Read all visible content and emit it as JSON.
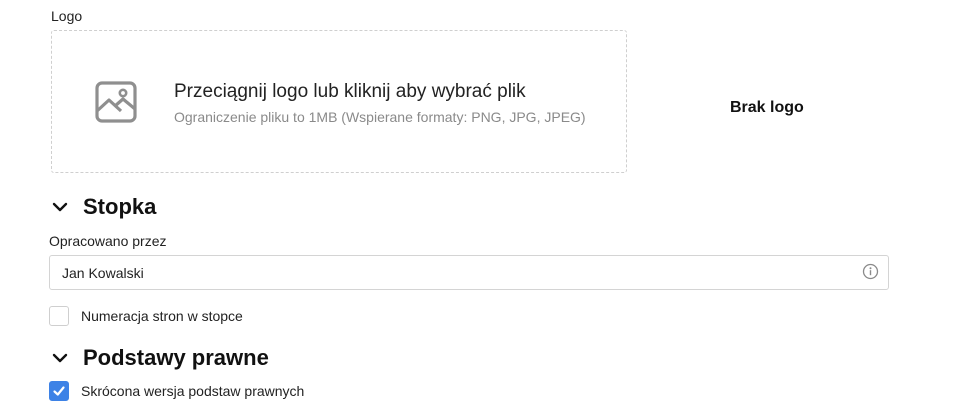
{
  "logo": {
    "label": "Logo",
    "dropzone_title": "Przeciągnij logo lub kliknij aby wybrać plik",
    "dropzone_subtitle": "Ograniczenie pliku to 1MB (Wspierane formaty: PNG, JPG, JPEG)",
    "dropzone_icon": "image-icon",
    "status": "Brak logo"
  },
  "footer_section": {
    "title": "Stopka",
    "chevron_icon": "chevron-down-icon",
    "prepared_by_label": "Opracowano przez",
    "prepared_by_value": "Jan Kowalski",
    "info_icon": "info-icon",
    "page_numbering_label": "Numeracja stron w stopce",
    "page_numbering_checked": false
  },
  "legal_section": {
    "title": "Podstawy prawne",
    "chevron_icon": "chevron-down-icon",
    "short_version_label": "Skrócona wersja podstaw prawnych",
    "short_version_checked": true
  },
  "colors": {
    "accent": "#3d82e6",
    "border": "#d4d4d4",
    "muted_text": "#8a8a8a"
  }
}
